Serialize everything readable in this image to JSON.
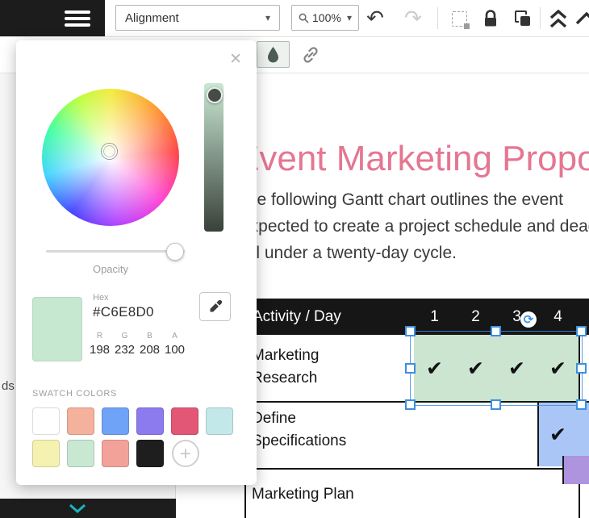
{
  "app": {
    "toolbar": {
      "alignment_label": "Alignment",
      "zoom_value": "100%",
      "undo_glyph": "↶",
      "redo_glyph": "↷",
      "caret_glyph": "▾"
    },
    "sidebar": {
      "clipped_text": "ds"
    }
  },
  "color_picker": {
    "close_glyph": "✕",
    "opacity_label": "Opacity",
    "hex_label": "Hex",
    "hex_value": "#C6E8D0",
    "channel_labels": [
      "R",
      "G",
      "B",
      "A"
    ],
    "channel_values": [
      "198",
      "232",
      "208",
      "100"
    ],
    "swatch_section_label": "SWATCH COLORS",
    "add_swatch_glyph": "+",
    "current_color": "#C6E8D0",
    "swatches_row1": [
      "#FFFFFF",
      "#F4B19C",
      "#6FA3F7",
      "#8C7AEF",
      "#E25776",
      "#C3E8E9"
    ],
    "swatches_row2": [
      "#F5F1B0",
      "#C8E8D2",
      "#F3A29A",
      "#1E1E1E"
    ]
  },
  "canvas": {
    "sync_glyph": "⟳",
    "document": {
      "title": "Event Marketing Proposal",
      "body_lines": [
        "The following Gantt chart outlines the event",
        "expected to create a project schedule and deadline,",
        "all under a twenty-day cycle."
      ],
      "table": {
        "header_label": "Activity / Day",
        "day_numbers": [
          "1",
          "2",
          "3",
          "4"
        ],
        "check_glyph": "✔",
        "rows": [
          {
            "label_line1": "Marketing",
            "label_line2": "Research"
          },
          {
            "label_line1": "Define",
            "label_line2": "Specifications"
          },
          {
            "label_line1": "Marketing Plan",
            "label_line2": ""
          }
        ],
        "fill_colors": {
          "research_row": "#CBE5D1",
          "specifications_row": "#A9C6F7",
          "plan_row": "#AE93DE"
        }
      }
    }
  }
}
